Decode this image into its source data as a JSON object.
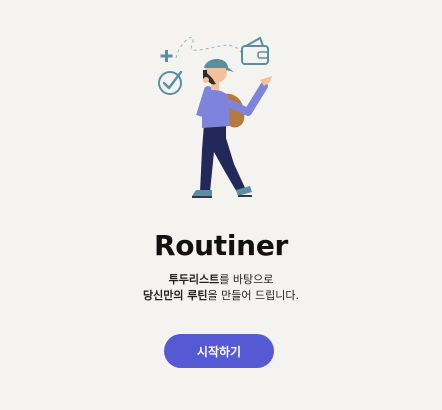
{
  "app": {
    "title": "Routiner"
  },
  "intro": {
    "line1_bold": "투두리스트",
    "line1_rest": "를 바탕으로",
    "line2_bold": "당신만의 루틴",
    "line2_rest": "을 만들어 드립니다."
  },
  "actions": {
    "start_label": "시작하기"
  },
  "icons": [
    "plus-icon",
    "checkmark-circle-icon",
    "wallet-icon",
    "person-character"
  ],
  "colors": {
    "background": "#f4f3ef",
    "accent": "#5659d4",
    "illustration_teal": "#5a8fa3",
    "shirt_purple": "#7e83dc",
    "pants_navy": "#23285a",
    "backpack_brown": "#b5793d"
  }
}
